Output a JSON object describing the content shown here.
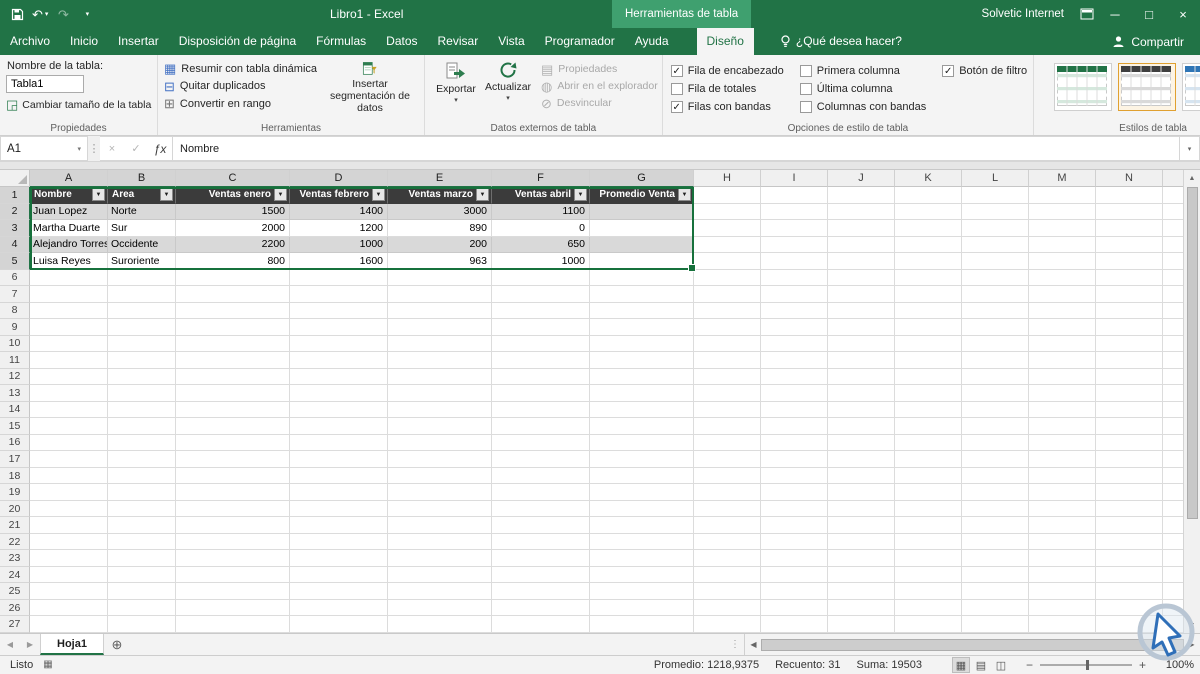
{
  "title_bar": {
    "workbook": "Libro1 - Excel",
    "contextual_label": "Herramientas de tabla",
    "account": "Solvetic Internet"
  },
  "share_label": "Compartir",
  "tabs": [
    {
      "label": "Archivo"
    },
    {
      "label": "Inicio"
    },
    {
      "label": "Insertar"
    },
    {
      "label": "Disposición de página"
    },
    {
      "label": "Fórmulas"
    },
    {
      "label": "Datos"
    },
    {
      "label": "Revisar"
    },
    {
      "label": "Vista"
    },
    {
      "label": "Programador"
    },
    {
      "label": "Ayuda"
    },
    {
      "label": "Diseño",
      "active": true,
      "gap_before": true
    },
    {
      "label": "¿Qué desea hacer?",
      "tellme": true
    }
  ],
  "ribbon": {
    "properties": {
      "label": "Propiedades",
      "table_name_label": "Nombre de la tabla:",
      "table_name_value": "Tabla1",
      "resize_label": "Cambiar tamaño de la tabla"
    },
    "tools": {
      "label": "Herramientas",
      "items": [
        "Resumir con tabla dinámica",
        "Quitar duplicados",
        "Convertir en rango"
      ],
      "slicer_label": "Insertar segmentación de datos"
    },
    "external": {
      "label": "Datos externos de tabla",
      "export_label": "Exportar",
      "refresh_label": "Actualizar",
      "disabled_items": [
        "Propiedades",
        "Abrir en el explorador",
        "Desvincular"
      ]
    },
    "style_options": {
      "label": "Opciones de estilo de tabla",
      "items": [
        {
          "label": "Fila de encabezado",
          "checked": true
        },
        {
          "label": "Fila de totales",
          "checked": false
        },
        {
          "label": "Filas con bandas",
          "checked": true
        },
        {
          "label": "Primera columna",
          "checked": false
        },
        {
          "label": "Última columna",
          "checked": false
        },
        {
          "label": "Columnas con bandas",
          "checked": false
        },
        {
          "label": "Botón de filtro",
          "checked": true
        }
      ]
    },
    "styles": {
      "label": "Estilos de tabla",
      "thumbnails": [
        {
          "header": "#217346",
          "stripe": "#d5e8dd",
          "selected": false
        },
        {
          "header": "#3f3f3f",
          "stripe": "#d9d9d9",
          "selected": true
        },
        {
          "header": "#2e75b6",
          "stripe": "#d6e4f0",
          "selected": false
        }
      ]
    }
  },
  "formula_bar": {
    "name_box": "A1",
    "content": "Nombre"
  },
  "grid": {
    "columns": [
      "A",
      "B",
      "C",
      "D",
      "E",
      "F",
      "G",
      "H",
      "I",
      "J",
      "K",
      "L",
      "M",
      "N"
    ],
    "rows": 27,
    "selected_cols": 7,
    "selected_rows": 5
  },
  "table": {
    "headers": [
      "Nombre",
      "Area",
      "Ventas enero",
      "Ventas febrero",
      "Ventas marzo",
      "Ventas abril",
      "Promedio Venta"
    ],
    "rows": [
      [
        "Juan Lopez",
        "Norte",
        "1500",
        "1400",
        "3000",
        "1100",
        ""
      ],
      [
        "Martha Duarte",
        "Sur",
        "2000",
        "1200",
        "890",
        "0",
        ""
      ],
      [
        "Alejandro Torres",
        "Occidente",
        "2200",
        "1000",
        "200",
        "650",
        ""
      ],
      [
        "Luisa Reyes",
        "Suroriente",
        "800",
        "1600",
        "963",
        "1000",
        ""
      ]
    ]
  },
  "sheet_bar": {
    "tabs": [
      "Hoja1"
    ]
  },
  "status_bar": {
    "ready": "Listo",
    "average": "Promedio: 1218,9375",
    "count": "Recuento: 31",
    "sum": "Suma: 19503",
    "zoom": "100%"
  },
  "colors": {
    "excel_green": "#217346",
    "contextual_green": "#3fa06f",
    "table_header": "#3b3b3b",
    "band_gray": "#d9d9d9",
    "selection_border": "#17713c"
  },
  "icons": {
    "undo-icon": "↶",
    "redo-icon": "↷",
    "qat-caret": "▾",
    "dropdown-caret": "▾",
    "minimize-icon": "─",
    "maximize-icon": "□",
    "close-icon": "×",
    "pivot-icon": "▦",
    "remove-duplicates-icon": "⊟",
    "convert-range-icon": "⊞",
    "resize-table-icon": "◲",
    "properties-disabled-icon": "▤",
    "browser-icon": "◍",
    "unlink-icon": "⊘",
    "name-box-caret": "▾",
    "cancel-icon": "×",
    "enter-icon": "✓",
    "fx-icon": "ƒx",
    "dots-icon": "⋮",
    "filter-caret": "▼",
    "prev-sheet-icon": "◀",
    "next-sheet-icon": "▶",
    "new-sheet-icon": "⊕",
    "scroll-up-icon": "▲",
    "scroll-down-icon": "▼",
    "scroll-left-icon": "◀",
    "scroll-right-icon": "▶",
    "view-normal-icon": "▦",
    "view-layout-icon": "▤",
    "view-break-icon": "◫",
    "zoom-out-icon": "−",
    "zoom-in-icon": "+",
    "styles-up-icon": "▲",
    "styles-down-icon": "▼",
    "styles-more-icon": "▼"
  }
}
